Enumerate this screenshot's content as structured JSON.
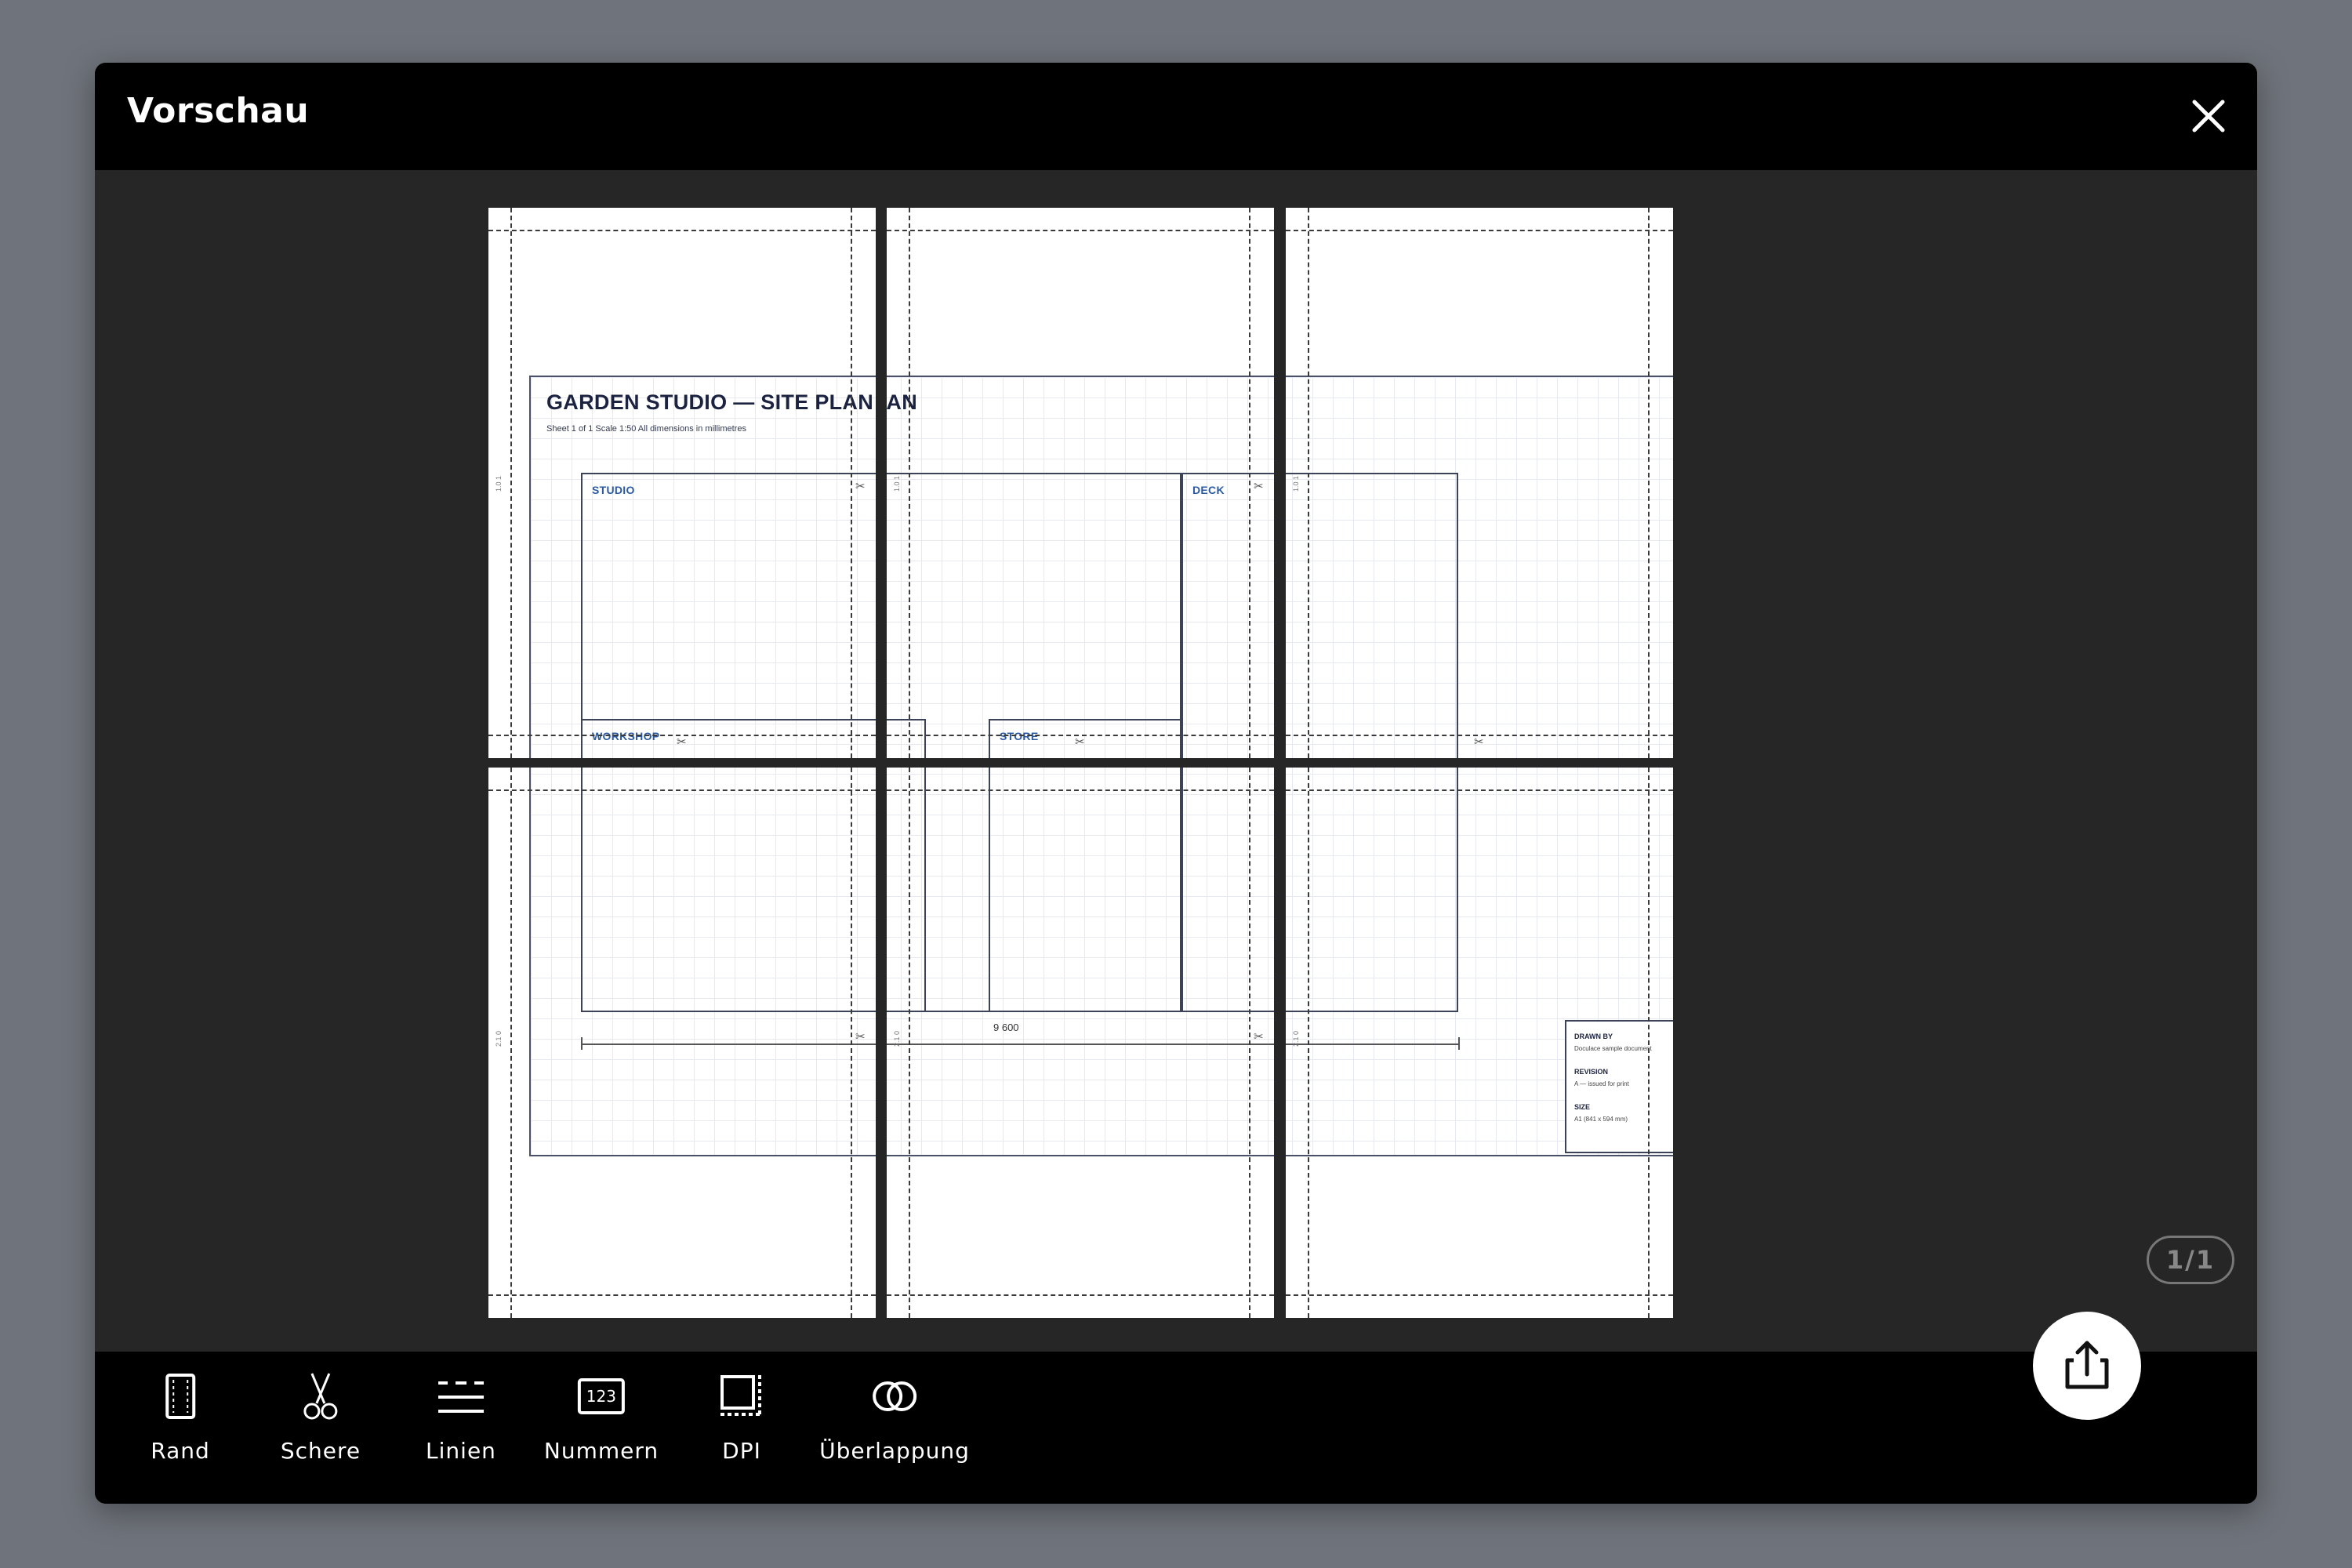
{
  "header": {
    "title": "Vorschau"
  },
  "document": {
    "title": "GARDEN STUDIO — SITE PLAN",
    "subtitle": "Sheet 1 of 1    Scale 1:50    All dimensions in millimetres",
    "rooms": {
      "studio": "STUDIO",
      "deck": "DECK",
      "workshop": "WORKSHOP",
      "store": "STORE"
    },
    "dimension": "9 600",
    "titleblock": {
      "drawn_by_label": "DRAWN BY",
      "drawn_by_value": "Doculace sample document",
      "revision_label": "REVISION",
      "revision_value": "A — issued for print",
      "size_label": "SIZE",
      "size_value": "A1 (841 x 594 mm)"
    },
    "overlap_label_top": "1.0 1",
    "overlap_label_bottom": "2.1 0"
  },
  "pagination": {
    "indicator": "1/1"
  },
  "toolbar": {
    "tools": [
      {
        "label": "Rand",
        "icon": "margin-icon"
      },
      {
        "label": "Schere",
        "icon": "scissors-icon"
      },
      {
        "label": "Linien",
        "icon": "lines-icon"
      },
      {
        "label": "Nummern",
        "icon": "numbers-icon"
      },
      {
        "label": "DPI",
        "icon": "dpi-icon"
      },
      {
        "label": "Überlappung",
        "icon": "overlap-icon"
      }
    ],
    "numbers_icon_text": "123",
    "share_icon": "share-icon"
  },
  "colors": {
    "header_bg": "#000000",
    "preview_bg": "#262626",
    "backdrop": "#6f737b",
    "room_label": "#2c5aa0"
  }
}
